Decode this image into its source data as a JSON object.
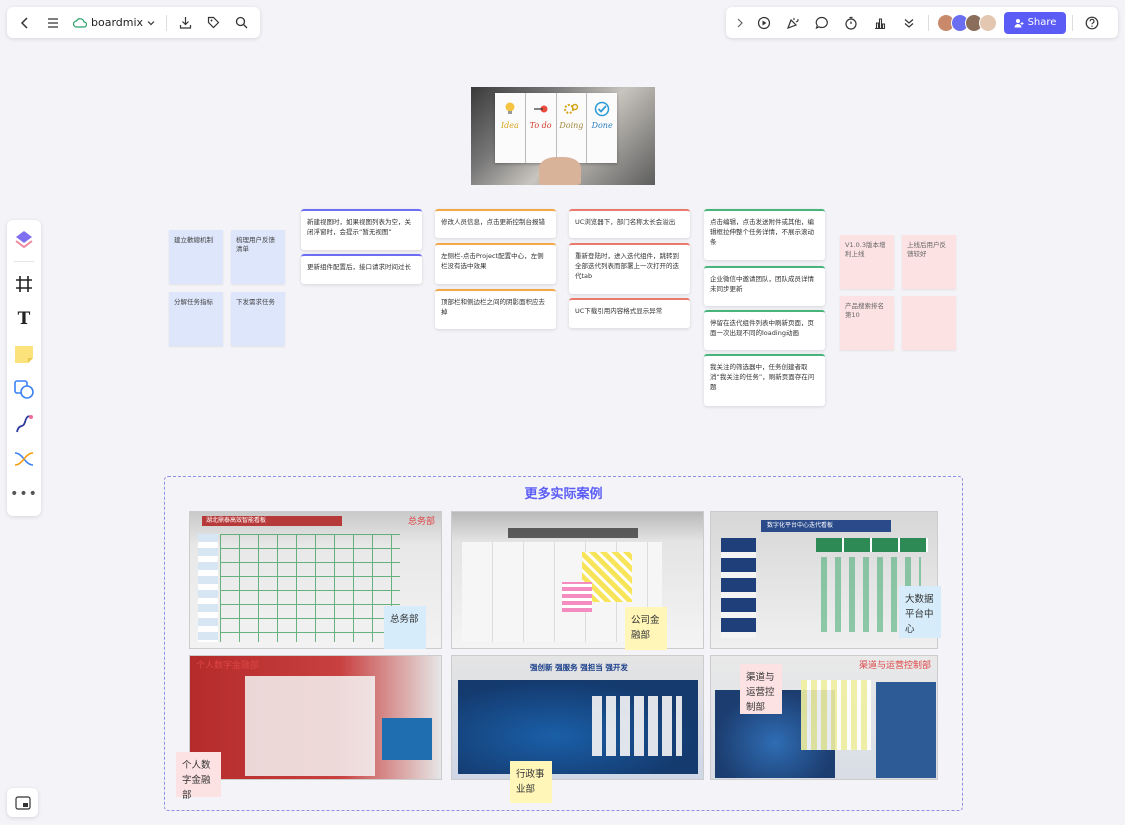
{
  "app": {
    "name": "boardmix",
    "share_label": "Share"
  },
  "hero": {
    "columns": [
      "Idea",
      "To do",
      "Doing",
      "Done"
    ]
  },
  "blue_notes": [
    {
      "text": "建立歡總机制"
    },
    {
      "text": "梳理用户反馈清单"
    },
    {
      "text": "分解任务指标"
    },
    {
      "text": "下发需求任务"
    }
  ],
  "pink_notes": [
    {
      "text": "V1.0.3版本增利上线"
    },
    {
      "text": "上线后用户反馈较好"
    },
    {
      "text": "产品搜索排名第10"
    },
    {
      "text": ""
    }
  ],
  "cards_col1": [
    {
      "text": "新建视图时，如果视图列表为空，关闭浮窗时，会提示“暂无视图”"
    },
    {
      "text": "更新组件配置后，接口请求时间过长"
    }
  ],
  "cards_col2": [
    {
      "text": "修改人员信息，点击更新控制台报错"
    },
    {
      "text": "左侧栏-点击Project配置中心，左侧栏没有选中效果"
    },
    {
      "text": "顶部栏和侧边栏之间的阴影面积应去掉"
    }
  ],
  "cards_col3": [
    {
      "text": "UC浏览器下，部门名称太长会溢出"
    },
    {
      "text": "重新登陆时，进入迭代组件，跳转到全部迭代列表而部署上一次打开的迭代tab"
    },
    {
      "text": "UC下载引用内容格式显示异常"
    }
  ],
  "cards_col4": [
    {
      "text": "点击编辑，点击发送附件或其他，编辑框拉伸整个任务详情，不展示滚动条"
    },
    {
      "text": "企业微信中邀请团队，团队成员详情未同步更新"
    },
    {
      "text": "停留在迭代组件列表中刷新页面，页面一次出现不同的loading动画"
    },
    {
      "text": "我关注的筛选器中，任务创建者取消“我关注的任务”，刷新页面存在问题"
    }
  ],
  "frame": {
    "title": "更多实际案例",
    "photos": [
      {
        "caption": "总务部",
        "board_title": "湖北鼎泰高效智能看板"
      },
      {
        "caption": "",
        "board_title": ""
      },
      {
        "caption": "",
        "board_title": "数字化平台中心迭代看板"
      },
      {
        "caption": "个人数字金融部",
        "board_title": ""
      },
      {
        "caption": "行政事业部",
        "board_title": "强创新 强服务 强担当 强开发"
      },
      {
        "caption": "渠道与运营控制部",
        "board_title": ""
      }
    ],
    "labels": [
      {
        "text": "总务部"
      },
      {
        "text": "公司金融部"
      },
      {
        "text": "大数据平台中心"
      },
      {
        "text": "渠道与运营控制部"
      },
      {
        "text": "个人数字金融部"
      },
      {
        "text": "行政事业部"
      }
    ]
  }
}
